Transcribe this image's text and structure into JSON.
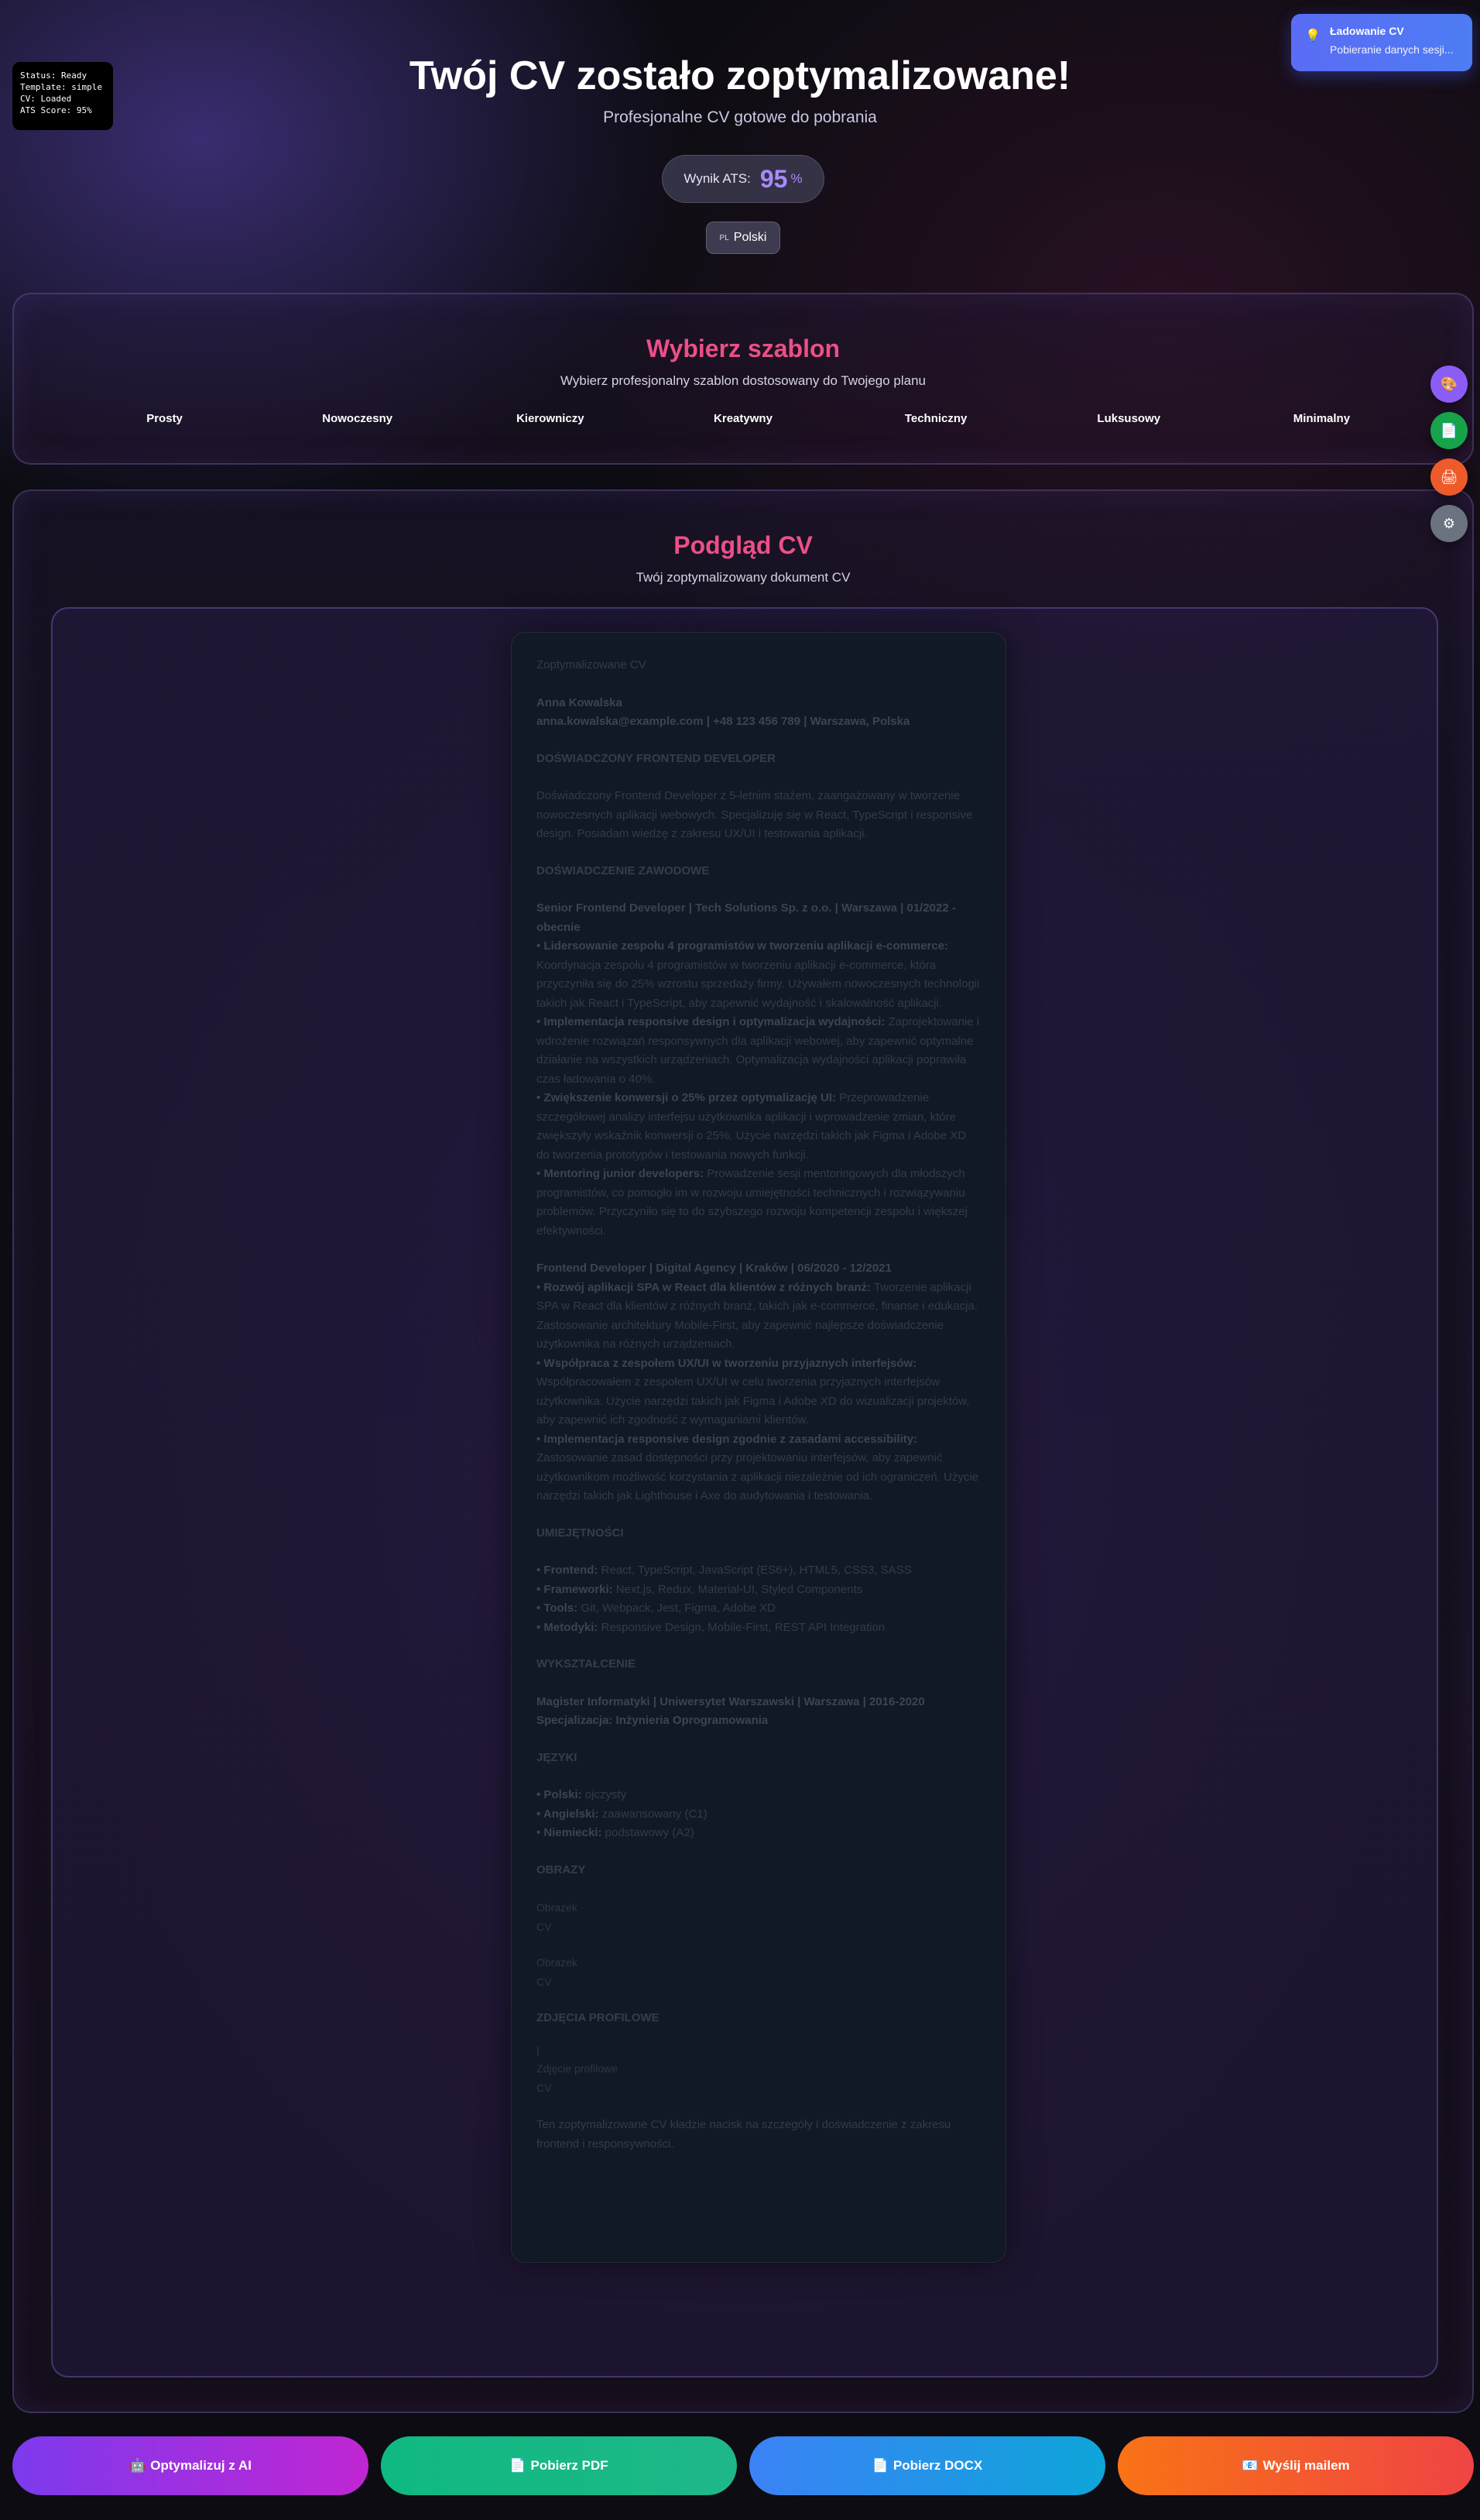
{
  "debug": {
    "status": "Status: Ready",
    "template": "Template: simple",
    "cv": "CV: Loaded",
    "ats": "ATS Score: 95%"
  },
  "toast": {
    "title": "Ładowanie CV",
    "body": "Pobieranie danych sesji..."
  },
  "header": {
    "title": "Twój CV zostało zoptymalizowane!",
    "subtitle": "Profesjonalne CV gotowe do pobrania",
    "ats_label": "Wynik ATS:",
    "ats_value": "95",
    "ats_unit": "%",
    "language_flag": "PL",
    "language_label": "Polski"
  },
  "templates": {
    "title": "Wybierz szablon",
    "subtitle": "Wybierz profesjonalny szablon dostosowany do Twojego planu",
    "items": [
      {
        "label": "Prosty"
      },
      {
        "label": "Nowoczesny"
      },
      {
        "label": "Kierowniczy"
      },
      {
        "label": "Kreatywny"
      },
      {
        "label": "Techniczny"
      },
      {
        "label": "Luksusowy"
      },
      {
        "label": "Minimalny"
      }
    ]
  },
  "side_buttons": [
    "palette-icon",
    "document-icon",
    "printer-icon",
    "gear-icon"
  ],
  "preview": {
    "title": "Podgląd CV",
    "subtitle": "Twój zoptymalizowany dokument CV"
  },
  "cv": {
    "intro": "Zoptymalizowane CV",
    "name": "Anna Kowalska",
    "contact": "anna.kowalska@example.com | +48 123 456 789 | Warszawa, Polska",
    "headline": "DOŚWIADCZONY FRONTEND DEVELOPER",
    "summary": "Doświadczony Frontend Developer z 5-letnim stażem, zaangażowany w tworzenie nowoczesnych aplikacji webowych. Specjalizuję się w React, TypeScript i responsive design. Posiadam wiedzę z zakresu UX/UI i testowania aplikacji.",
    "experience_heading": "DOŚWIADCZENIE ZAWODOWE",
    "job1_title": "Senior Frontend Developer | Tech Solutions Sp. z o.o. | Warszawa | 01/2022 - obecnie",
    "job1_b1_title": "• Lidersowanie zespołu 4 programistów w tworzeniu aplikacji e-commerce:",
    "job1_b1_text": "Koordynacja zespołu 4 programistów w tworzeniu aplikacji e-commerce, która przyczyniła się do 25% wzrostu sprzedaży firmy. Używałem nowoczesnych technologii takich jak React i TypeScript, aby zapewnić wydajność i skalowalność aplikacji.",
    "job1_b2_title": "• Implementacja responsive design i optymalizacja wydajności:",
    "job1_b2_text": "Zaprojektowanie i wdrożenie rozwiązań responsywnych dla aplikacji webowej, aby zapewnić optymalne działanie na wszystkich urządzeniach. Optymalizacja wydajności aplikacji poprawiła czas ładowania o 40%.",
    "job1_b3_title": "• Zwiększenie konwersji o 25% przez optymalizację UI:",
    "job1_b3_text": "Przeprowadzenie szczegółowej analizy interfejsu użytkownika aplikacji i wprowadzenie zmian, które zwiększyły wskaźnik konwersji o 25%. Użycie narzędzi takich jak Figma i Adobe XD do tworzenia prototypów i testowania nowych funkcji.",
    "job1_b4_title": "• Mentoring junior developers:",
    "job1_b4_text": "Prowadzenie sesji mentoringowych dla młodszych programistów, co pomogło im w rozwoju umiejętności technicznych i rozwiązywaniu problemów. Przyczyniło się to do szybszego rozwoju kompetencji zespołu i większej efektywności.",
    "job2_title": "Frontend Developer | Digital Agency | Kraków | 06/2020 - 12/2021",
    "job2_b1_title": "• Rozwój aplikacji SPA w React dla klientów z różnych branż:",
    "job2_b1_text": "Tworzenie aplikacji SPA w React dla klientów z różnych branż, takich jak e-commerce, finanse i edukacja. Zastosowanie architektury Mobile-First, aby zapewnić najlepsze doświadczenie użytkownika na różnych urządzeniach.",
    "job2_b2_title": "• Współpraca z zespołem UX/UI w tworzeniu przyjaznych interfejsów:",
    "job2_b2_text": "Współpracowałem z zespołem UX/UI w celu tworzenia przyjaznych interfejsów użytkownika. Użycie narzędzi takich jak Figma i Adobe XD do wizualizacji projektów, aby zapewnić ich zgodność z wymaganiami klientów.",
    "job2_b3_title": "• Implementacja responsive design zgodnie z zasadami accessibility:",
    "job2_b3_text": "Zastosowanie zasad dostępności przy projektowaniu interfejsów, aby zapewnić użytkownikom możliwość korzystania z aplikacji niezależnie od ich ograniczeń. Użycie narzędzi takich jak Lighthouse i Axe do audytowania i testowania.",
    "skills_heading": "UMIEJĘTNOŚCI",
    "skills": [
      {
        "label": "• Frontend:",
        "value": " React, TypeScript, JavaScript (ES6+), HTML5, CSS3, SASS"
      },
      {
        "label": "• Frameworki:",
        "value": " Next.js, Redux, Material-UI, Styled Components"
      },
      {
        "label": "• Tools:",
        "value": " Git, Webpack, Jest, Figma, Adobe XD"
      },
      {
        "label": "• Metodyki:",
        "value": " Responsive Design, Mobile-First, REST API Integration"
      }
    ],
    "education_heading": "WYKSZTAŁCENIE",
    "education_line1": "Magister Informatyki | Uniwersytet Warszawski | Warszawa | 2016-2020",
    "education_line2": "Specjalizacja: Inżynieria Oprogramowania",
    "languages_heading": "JĘZYKI",
    "languages": [
      {
        "label": "• Polski:",
        "value": " ojczysty"
      },
      {
        "label": "• Angielski:",
        "value": " zaawansowany (C1)"
      },
      {
        "label": "• Niemiecki:",
        "value": " podstawowy (A2)"
      }
    ],
    "images_heading": "OBRAZY",
    "image1_alt": "Obrazek",
    "image1_caption": "CV",
    "image2_alt": "Obrazek",
    "image2_caption": "CV",
    "photo_heading": "ZDJĘCIA PROFILOWE",
    "photo_marker": "|",
    "photo_alt": "Zdjęcie profilowe",
    "photo_caption": "CV",
    "footer_note": "Ten zoptymalizowane CV kładzie nacisk na szczegóły i doświadczenie z zakresu frontend i responsywności."
  },
  "actions": [
    {
      "icon": "robot-icon",
      "glyph": "🤖",
      "label": "Optymalizuj z AI"
    },
    {
      "icon": "document-icon",
      "glyph": "📄",
      "label": "Pobierz PDF"
    },
    {
      "icon": "document-icon",
      "glyph": "📄",
      "label": "Pobierz DOCX"
    },
    {
      "icon": "mail-icon",
      "glyph": "📧",
      "label": "Wyślij mailem"
    }
  ],
  "colors": {
    "accent_pink": "#ec4f88",
    "ats_purple": "#a78bfa",
    "toast_blue": "#5b6cf5"
  }
}
